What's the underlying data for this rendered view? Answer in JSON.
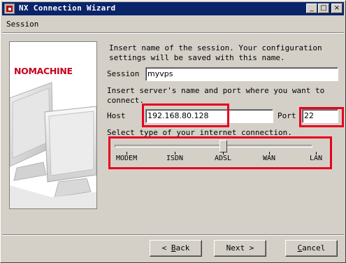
{
  "window": {
    "title": "NX Connection Wizard",
    "minimize_glyph": "_",
    "maximize_glyph": "□",
    "close_glyph": "×"
  },
  "menu": {
    "section": "Session"
  },
  "side_panel": {
    "logo_text": "NOMACHINE"
  },
  "form": {
    "intro_line1": "Insert name of the session. Your configuration",
    "intro_line2": "settings will be saved with this name.",
    "session_label": "Session",
    "session_value": "myvps",
    "server_line1": "Insert server's name and port where you want to",
    "server_line2": "connect.",
    "host_label": "Host",
    "host_value": "192.168.80.128",
    "port_label": "Port",
    "port_value": "22",
    "connection_prompt": "Select type of your internet connection."
  },
  "connection_slider": {
    "options": [
      "MODEM",
      "ISDN",
      "ADSL",
      "WAN",
      "LAN"
    ],
    "selected": "ADSL",
    "selected_index": 2
  },
  "buttons": {
    "back_arrow": "<",
    "back_mnemonic": "B",
    "back_rest": "ack",
    "next_label": "Next",
    "next_arrow": ">",
    "cancel_mnemonic": "C",
    "cancel_rest": "ancel"
  },
  "colors": {
    "titlebar": "#0a246a",
    "highlight_box": "#e8001e",
    "logo": "#c8001e",
    "dialog_bg": "#d4d0c8"
  }
}
